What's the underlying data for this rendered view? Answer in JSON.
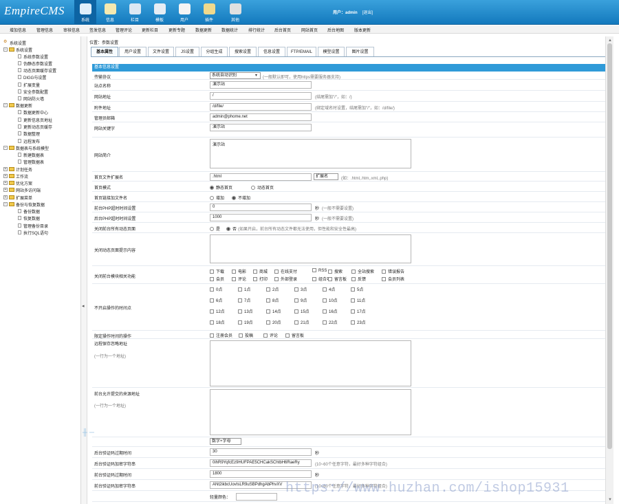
{
  "app": {
    "logo": "EmpireCMS",
    "user": "用户：admin",
    "logout": "[退出]"
  },
  "mainnav": [
    {
      "label": "系统",
      "icon": "globe-icon",
      "color": "#dfeffa"
    },
    {
      "label": "信息",
      "icon": "document-icon",
      "color": "#f5e9b0"
    },
    {
      "label": "栏目",
      "icon": "folder-icon",
      "color": "#dce8f3"
    },
    {
      "label": "模板",
      "icon": "template-icon",
      "color": "#e6edf4"
    },
    {
      "label": "用户",
      "icon": "user-icon",
      "color": "#f4f4f4"
    },
    {
      "label": "插件",
      "icon": "tools-icon",
      "color": "#f0d98c"
    },
    {
      "label": "其他",
      "icon": "gear-icon",
      "color": "#e0e0e0"
    }
  ],
  "subnav": [
    "增加信息",
    "管理信息",
    "审核信息",
    "签发信息",
    "管理评论",
    "更新栏目",
    "更新专题",
    "数据更新",
    "数据统计",
    "排行统计",
    "后台首页",
    "网站首页",
    "后台地图",
    "版本更新"
  ],
  "sidebar": [
    "系统设置",
    "系统设置",
    "系统参数设置",
    "伪静态参数设置",
    "动态页面缓存设置",
    "DIGG与设置",
    "扩展变量",
    "安全参数配置",
    "网站防火墙",
    "数据更新",
    "数据更新中心",
    "更新信息页地址",
    "更新动态页缓存",
    "数据整理",
    "远程发布",
    "数据表与系统模型",
    "新建数据表",
    "管理数据表",
    "计划任务",
    "工作流",
    "优化方案",
    "网站多访问端",
    "扩展菜单",
    "备份与恢复数据",
    "备份数据",
    "恢复数据",
    "管理备份目录",
    "执行SQL语句"
  ],
  "crumb": "位置：参数设置",
  "tabs": [
    "基本属性",
    "用户设置",
    "文件设置",
    "JS设置",
    "分组生成",
    "搜索设置",
    "信息设置",
    "FTP/EMAIL",
    "模型设置",
    "图片设置"
  ],
  "section": "基本信息设置",
  "fields": {
    "protocol": {
      "label": "传输协议",
      "value": "系统自动识别",
      "note": "(一般默认即可，使用https需要服务器支持)"
    },
    "site_name": {
      "label": "站点名称",
      "value": "演示站"
    },
    "site_url": {
      "label": "网站地址",
      "value": "/",
      "note": "(结尾需加\"/\"，如：/)"
    },
    "file_url": {
      "label": "附件地址",
      "value": "/d/file/",
      "note": "(绑定域名时设置，结尾需加\"/\"，如：/d/file/)"
    },
    "admin_email": {
      "label": "管理员邮箱",
      "value": "admin@phome.net"
    },
    "keywords": {
      "label": "网站关键字",
      "value": "演示站"
    },
    "intro": {
      "label": "网站简介",
      "value": "演示站"
    },
    "index_ext": {
      "label": "首页文件扩展名",
      "value": ".html",
      "ext_select": "扩展名",
      "note": "(如：.html,.htm,.xml,.php)"
    },
    "index_mode": {
      "label": "首页模式",
      "opt1": "静态首页",
      "opt2": "动态首页"
    },
    "index_link": {
      "label": "首页链接加文件名",
      "opt1": "增加",
      "opt2": "不增加"
    },
    "front_timeout": {
      "label": "前台PHP超时时间设置",
      "value": "0",
      "unit": "秒",
      "note": "(一般不需要设置)"
    },
    "back_timeout": {
      "label": "后台PHP超时时间设置",
      "value": "1000",
      "unit": "秒",
      "note": "(一般不需要设置)"
    },
    "close_dynamic": {
      "label": "关闭前台所有动态页面",
      "opt1": "是",
      "opt2": "否",
      "note": "(如果开启，前台所有动态文件都无法使用，但性能和安全性最高)"
    },
    "close_tip": {
      "label": "关闭动态页面提示内容"
    },
    "close_modules": {
      "label": "关闭前台模块相关功能",
      "items": [
        "下载",
        "电影",
        "商城",
        "在线支付",
        "RSS",
        "搜索",
        "全站搜索",
        "错误报告",
        "会员",
        "评论",
        "打印",
        "外部登录",
        "组合项",
        "留言板",
        "反馈",
        "会员列表"
      ]
    },
    "no_hours": {
      "label": "不开启操作的时间点",
      "hours": [
        "0点",
        "1点",
        "2点",
        "3点",
        "4点",
        "5点",
        "6点",
        "7点",
        "8点",
        "9点",
        "10点",
        "11点",
        "12点",
        "13点",
        "14点",
        "15点",
        "16点",
        "17点",
        "18点",
        "19点",
        "20点",
        "21点",
        "22点",
        "23点"
      ]
    },
    "limit_ops": {
      "label": "限定操作时间的操作",
      "items": [
        "注册会员",
        "投稿",
        "评论",
        "留言板"
      ]
    },
    "remote_ignore": {
      "label": "远程保存忽略地址",
      "sub": "(一行为一个地址)"
    },
    "allow_src": {
      "label": "前台允许提交的来源地址",
      "sub": "(一行为一个地址)"
    },
    "code_type": {
      "value": "数字+字母"
    },
    "back_code_expire": {
      "label": "后台验证码过期时间",
      "value": "30",
      "unit": "秒"
    },
    "back_code_key": {
      "label": "后台验证码加密字符串",
      "value": "0ihR9YqfcEz9HUFPAE5CHCakSChtbH6RaeRy",
      "note": "(10~60个任意字符，最好多种字符组合)"
    },
    "front_code_expire": {
      "label": "前台验证码过期时间",
      "value": "1800",
      "unit": "秒"
    },
    "front_code_key": {
      "label": "前台验证码加密字符串",
      "value": "ANt2ikbcUovIsLR9uSBPdhgAbPhvXV",
      "note": "(10~60个任意字符，最好多种字符组合)"
    },
    "last_row": {
      "label": "轻量颜色："
    }
  },
  "watermark": "https://www.huzhan.com/ishop15931"
}
